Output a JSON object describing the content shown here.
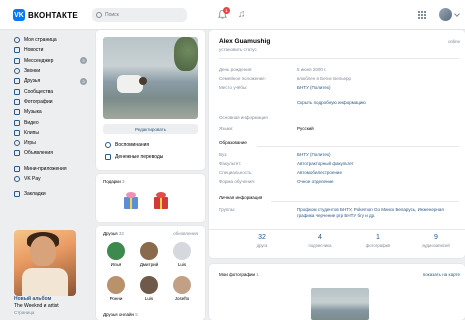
{
  "header": {
    "logo_mark": "VK",
    "logo_text": "ВКОНТАКТЕ",
    "search_placeholder": "Поиск",
    "notifications_count": "1",
    "music_glyph": "♫"
  },
  "nav": {
    "items": [
      {
        "label": "Моя страница",
        "icon": "home-icon",
        "badge": ""
      },
      {
        "label": "Новости",
        "icon": "news-icon",
        "badge": ""
      },
      {
        "label": "Мессенджер",
        "icon": "chat-icon",
        "badge": "3"
      },
      {
        "label": "Звонки",
        "icon": "phone-icon",
        "badge": ""
      },
      {
        "label": "Друзья",
        "icon": "friends-icon",
        "badge": "3"
      },
      {
        "label": "Сообщества",
        "icon": "groups-icon",
        "badge": ""
      },
      {
        "label": "Фотографии",
        "icon": "photo-icon",
        "badge": ""
      },
      {
        "label": "Музыка",
        "icon": "music-icon",
        "badge": ""
      },
      {
        "label": "Видео",
        "icon": "video-icon",
        "badge": ""
      },
      {
        "label": "Клипы",
        "icon": "clips-icon",
        "badge": ""
      },
      {
        "label": "Игры",
        "icon": "games-icon",
        "badge": ""
      },
      {
        "label": "Объявления",
        "icon": "ads-icon",
        "badge": ""
      }
    ],
    "items2": [
      {
        "label": "Мини-приложения",
        "icon": "apps-icon"
      },
      {
        "label": "VK Pay",
        "icon": "vkpay-icon"
      }
    ],
    "items3": [
      {
        "label": "Закладки",
        "icon": "bookmark-icon"
      }
    ],
    "promo": {
      "title": "Новый альбом",
      "subtitle": "The Weeknd и artist",
      "caption": "Страница"
    }
  },
  "photo_card": {
    "edit_label": "Редактировать",
    "links": [
      {
        "label": "Воспоминания",
        "icon": "memories-icon"
      },
      {
        "label": "Денежные переводы",
        "icon": "money-icon"
      }
    ]
  },
  "gifts": {
    "title": "Подарки",
    "count": "3"
  },
  "friends": {
    "title": "Друзья",
    "count": "32",
    "updates": "обновления",
    "items": [
      {
        "name": "Илья",
        "color": "#3c8a4e"
      },
      {
        "name": "Дмитрий",
        "color": "#8a6a4c"
      },
      {
        "name": "Luis",
        "color": "#d5d8dd"
      },
      {
        "name": "Ронни",
        "color": "#b9916b"
      },
      {
        "name": "Luis",
        "color": "#6f5a4a"
      },
      {
        "name": "Josefto",
        "color": "#c2a085"
      }
    ],
    "online_title": "Друзья онлайн",
    "online_count": "5"
  },
  "profile": {
    "name": "Alex Guamushig",
    "status": "установить статус",
    "online": "online",
    "rows": [
      {
        "k": "День рождения:",
        "v": "5 июня 2000 г."
      },
      {
        "k": "Семейное положение:",
        "v": "влюблен в Бегис Бельерр"
      },
      {
        "k": "Место учёбы:",
        "v": "БНТУ (Политех)"
      }
    ],
    "more": "Скрыть подробную информацию",
    "basic_title": "Основная информация",
    "lang_k": "Языки:",
    "lang_v": "Русский",
    "edu_title": "Образование",
    "edu_rows": [
      {
        "k": "Вуз:",
        "v": "БНТУ (Политех)"
      },
      {
        "k": "Факультет:",
        "v": "Автотракторный факультет"
      },
      {
        "k": "Специальность:",
        "v": "Автомобилестроение"
      },
      {
        "k": "Форма обучения:",
        "v": "Очное отделение"
      }
    ],
    "personal_title": "Личная информация",
    "groups_k": "Группы:",
    "groups_v": "Профком студентов БНТУ, Pokemon Go Минск Беларусь, Инженерная графика черчение ргр БНТУ бгу и др.",
    "counters": [
      {
        "n": "32",
        "l": "друга"
      },
      {
        "n": "4",
        "l": "подписчика"
      },
      {
        "n": "1",
        "l": "фотография"
      },
      {
        "n": "9",
        "l": "аудиозаписей"
      }
    ]
  },
  "photos": {
    "title": "Мои фотографии",
    "count": "1",
    "all": "показать на карте"
  }
}
